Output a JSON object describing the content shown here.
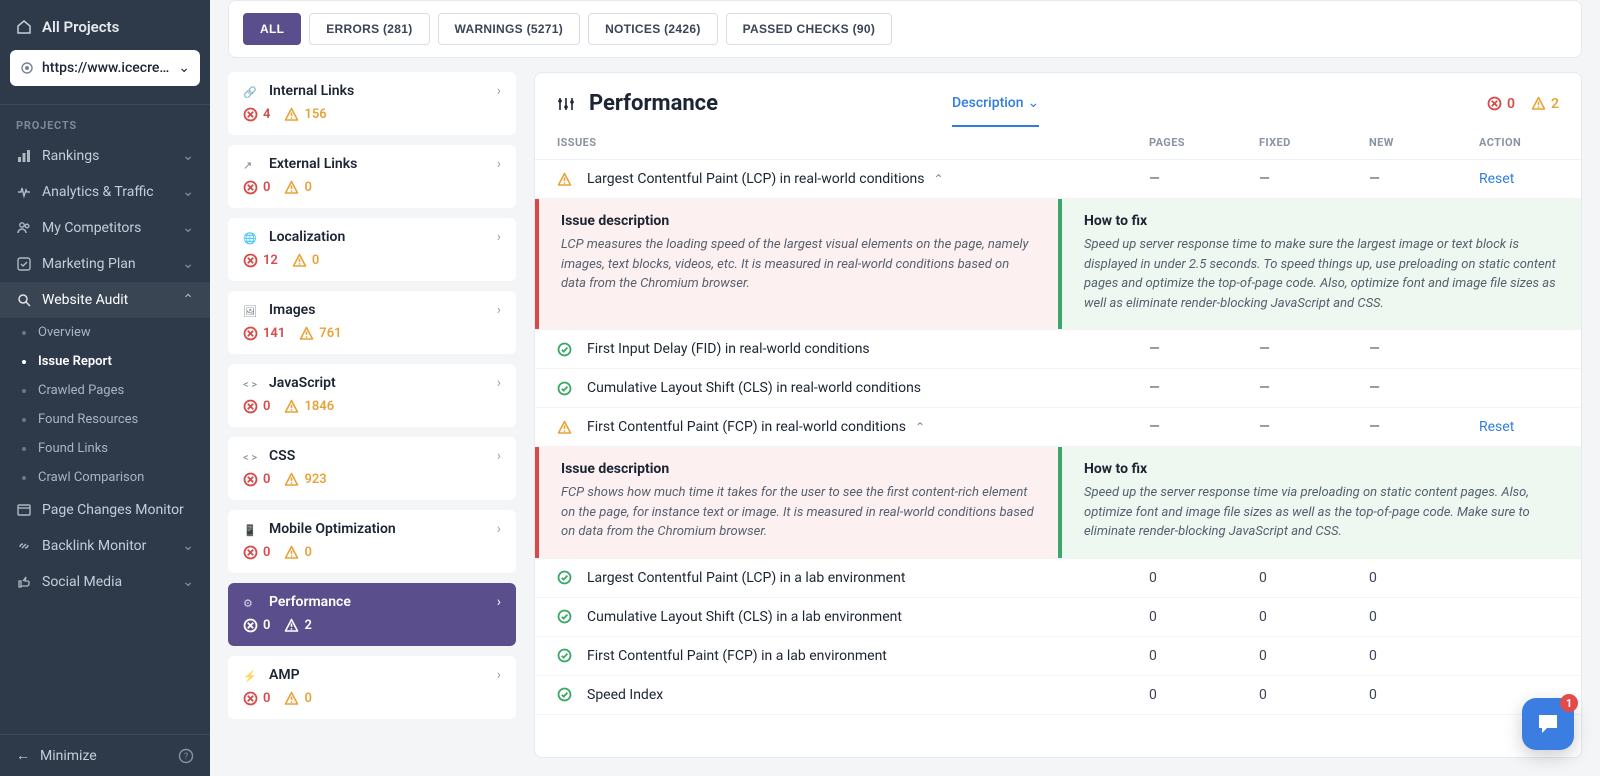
{
  "sidebar": {
    "all_projects": "All Projects",
    "project_url": "https://www.icecream...",
    "section_label": "PROJECTS",
    "items": [
      {
        "label": "Rankings"
      },
      {
        "label": "Analytics & Traffic"
      },
      {
        "label": "My Competitors"
      },
      {
        "label": "Marketing Plan"
      },
      {
        "label": "Website Audit"
      },
      {
        "label": "Page Changes Monitor"
      },
      {
        "label": "Backlink Monitor"
      },
      {
        "label": "Social Media"
      }
    ],
    "audit_sub": [
      {
        "label": "Overview"
      },
      {
        "label": "Issue Report"
      },
      {
        "label": "Crawled Pages"
      },
      {
        "label": "Found Resources"
      },
      {
        "label": "Found Links"
      },
      {
        "label": "Crawl Comparison"
      }
    ],
    "minimize": "Minimize"
  },
  "filters": {
    "all": "ALL",
    "errors": "ERRORS (281)",
    "warnings": "WARNINGS (5271)",
    "notices": "NOTICES (2426)",
    "passed": "PASSED CHECKS (90)"
  },
  "categories": [
    {
      "title": "Internal Links",
      "err": "4",
      "warn": "156"
    },
    {
      "title": "External Links",
      "err": "0",
      "warn": "0"
    },
    {
      "title": "Localization",
      "err": "12",
      "warn": "0"
    },
    {
      "title": "Images",
      "err": "141",
      "warn": "761"
    },
    {
      "title": "JavaScript",
      "err": "0",
      "warn": "1846"
    },
    {
      "title": "CSS",
      "err": "0",
      "warn": "923"
    },
    {
      "title": "Mobile Optimization",
      "err": "0",
      "warn": "0"
    },
    {
      "title": "Performance",
      "err": "0",
      "warn": "2"
    },
    {
      "title": "AMP",
      "err": "0",
      "warn": "0"
    }
  ],
  "detail": {
    "title": "Performance",
    "dropdown": "Description",
    "sum_err": "0",
    "sum_warn": "2",
    "headers": {
      "issues": "ISSUES",
      "pages": "PAGES",
      "fixed": "FIXED",
      "new": "NEW",
      "action": "ACTION"
    },
    "rows": [
      {
        "status": "warn",
        "name": "Largest Contentful Paint (LCP) in real-world conditions",
        "pages": "—",
        "fixed": "—",
        "new": "—",
        "action": "Reset",
        "expanded": true,
        "desc_h": "Issue description",
        "desc": "LCP measures the loading speed of the largest visual elements on the page, namely images, text blocks, videos, etc. It is measured in real-world conditions based on data from the Chromium browser.",
        "fix_h": "How to fix",
        "fix": "Speed up server response time to make sure the largest image or text block is displayed in under 2.5 seconds. To speed things up, use preloading on static content pages and optimize the top-of-page code. Also, optimize font and image file sizes as well as eliminate render-blocking JavaScript and CSS."
      },
      {
        "status": "ok",
        "name": "First Input Delay (FID) in real-world conditions",
        "pages": "—",
        "fixed": "—",
        "new": "—",
        "action": ""
      },
      {
        "status": "ok",
        "name": "Cumulative Layout Shift (CLS) in real-world conditions",
        "pages": "—",
        "fixed": "—",
        "new": "—",
        "action": ""
      },
      {
        "status": "warn",
        "name": "First Contentful Paint (FCP) in real-world conditions",
        "pages": "—",
        "fixed": "—",
        "new": "—",
        "action": "Reset",
        "expanded": true,
        "desc_h": "Issue description",
        "desc": "FCP shows how much time it takes for the user to see the first content-rich element on the page, for instance text or image. It is measured in real-world conditions based on data from the Chromium browser.",
        "fix_h": "How to fix",
        "fix": "Speed up the server response time via preloading on static content pages. Also, optimize font and image file sizes as well as the top-of-page code. Make sure to eliminate render-blocking JavaScript and CSS."
      },
      {
        "status": "ok",
        "name": "Largest Contentful Paint (LCP) in a lab environment",
        "pages": "0",
        "fixed": "0",
        "new": "0",
        "action": ""
      },
      {
        "status": "ok",
        "name": "Cumulative Layout Shift (CLS) in a lab environment",
        "pages": "0",
        "fixed": "0",
        "new": "0",
        "action": ""
      },
      {
        "status": "ok",
        "name": "First Contentful Paint (FCP) in a lab environment",
        "pages": "0",
        "fixed": "0",
        "new": "0",
        "action": ""
      },
      {
        "status": "ok",
        "name": "Speed Index",
        "pages": "0",
        "fixed": "0",
        "new": "0",
        "action": ""
      }
    ]
  },
  "chat_notif": "1"
}
